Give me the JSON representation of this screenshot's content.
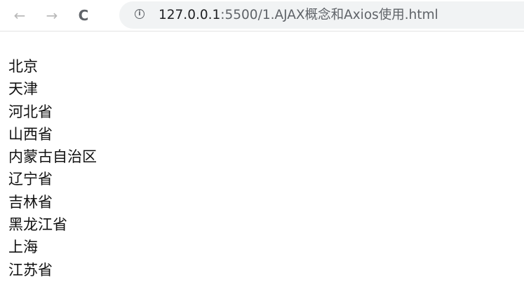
{
  "toolbar": {
    "back_icon": "arrow-left-icon",
    "forward_icon": "arrow-right-icon",
    "reload_icon": "reload-icon",
    "info_icon": "info-icon",
    "url_host": "127.0.0.1",
    "url_rest": ":5500/1.AJAX概念和Axios使用.html"
  },
  "provinces": [
    "北京",
    "天津",
    "河北省",
    "山西省",
    "内蒙古自治区",
    "辽宁省",
    "吉林省",
    "黑龙江省",
    "上海",
    "江苏省"
  ],
  "colors": {
    "omnibox_bg": "#f1f3f4",
    "text": "#111111",
    "disabled_icon": "#b8b8b8"
  }
}
